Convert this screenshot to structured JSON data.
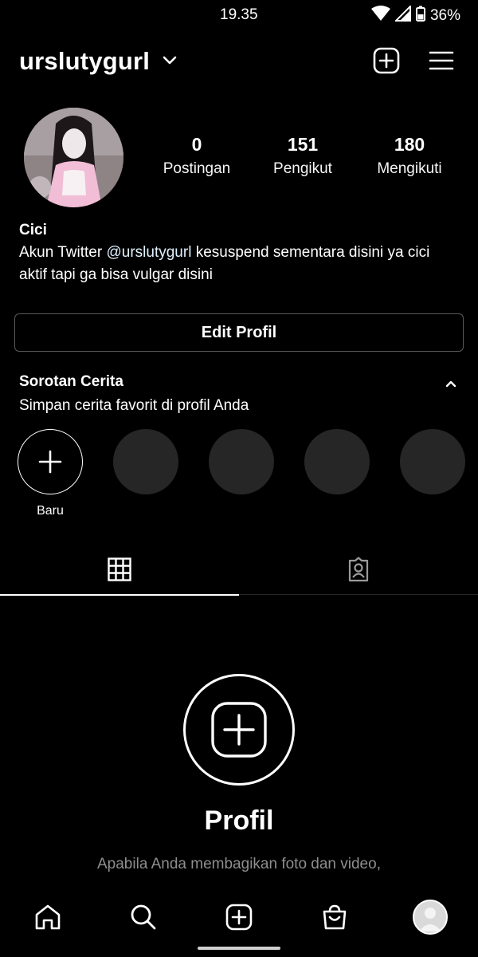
{
  "status_bar": {
    "time": "19.35",
    "battery": "36%",
    "icons": [
      "wifi-icon",
      "signal-icon",
      "battery-icon"
    ]
  },
  "header": {
    "username": "urslutygurl",
    "icons": [
      "chevron-down-icon",
      "new-post-icon",
      "menu-icon"
    ]
  },
  "profile": {
    "stats": [
      {
        "value": "0",
        "label": "Postingan"
      },
      {
        "value": "151",
        "label": "Pengikut"
      },
      {
        "value": "180",
        "label": "Mengikuti"
      }
    ],
    "name": "Cici",
    "bio_prefix": "Akun Twitter ",
    "bio_mention": "@urslutygurl",
    "bio_suffix": " kesuspend sementara disini ya cici aktif tapi ga bisa vulgar disini"
  },
  "edit_button": "Edit Profil",
  "highlights": {
    "title": "Sorotan Cerita",
    "subtitle": "Simpan cerita favorit di profil Anda",
    "new_label": "Baru"
  },
  "tabs": [
    {
      "name": "grid",
      "icon": "grid-icon",
      "active": true
    },
    {
      "name": "tagged",
      "icon": "tagged-icon",
      "active": false
    }
  ],
  "empty_state": {
    "title": "Profil",
    "description": "Apabila Anda membagikan foto dan video,"
  },
  "bottom_nav": [
    "home-icon",
    "search-icon",
    "create-icon",
    "shop-icon",
    "profile-avatar"
  ],
  "colors": {
    "background": "#000000",
    "text": "#ffffff",
    "muted": "#8e8e8e",
    "placeholder_circle": "#262626"
  }
}
